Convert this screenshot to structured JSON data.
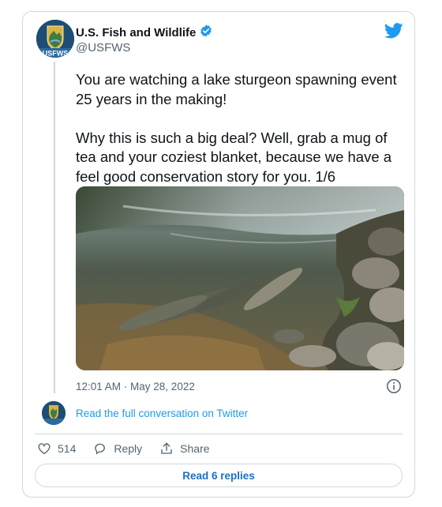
{
  "author": {
    "name": "U.S. Fish and Wildlife",
    "handle": "@USFWS",
    "avatar_text": "USFWS",
    "verified_icon": "verified-badge-icon"
  },
  "tweet": {
    "text": "You are watching a lake sturgeon spawning event 25 years in the making!\n\nWhy this is such a big deal? Well, grab a mug of tea and your coziest blanket, because we have a feel good conservation story for you. 1/6",
    "timestamp": "12:01 AM · May 28, 2022",
    "media_icon": "video-thumbnail"
  },
  "conversation": {
    "link_label": "Read the full conversation on Twitter"
  },
  "actions": {
    "likes_count": "514",
    "reply_label": "Reply",
    "share_label": "Share"
  },
  "replies_button": {
    "label": "Read 6 replies"
  },
  "colors": {
    "accent": "#1d9bf0",
    "border": "#cfd9de",
    "muted": "#536471",
    "reply_button_text": "#1d6fc1"
  }
}
